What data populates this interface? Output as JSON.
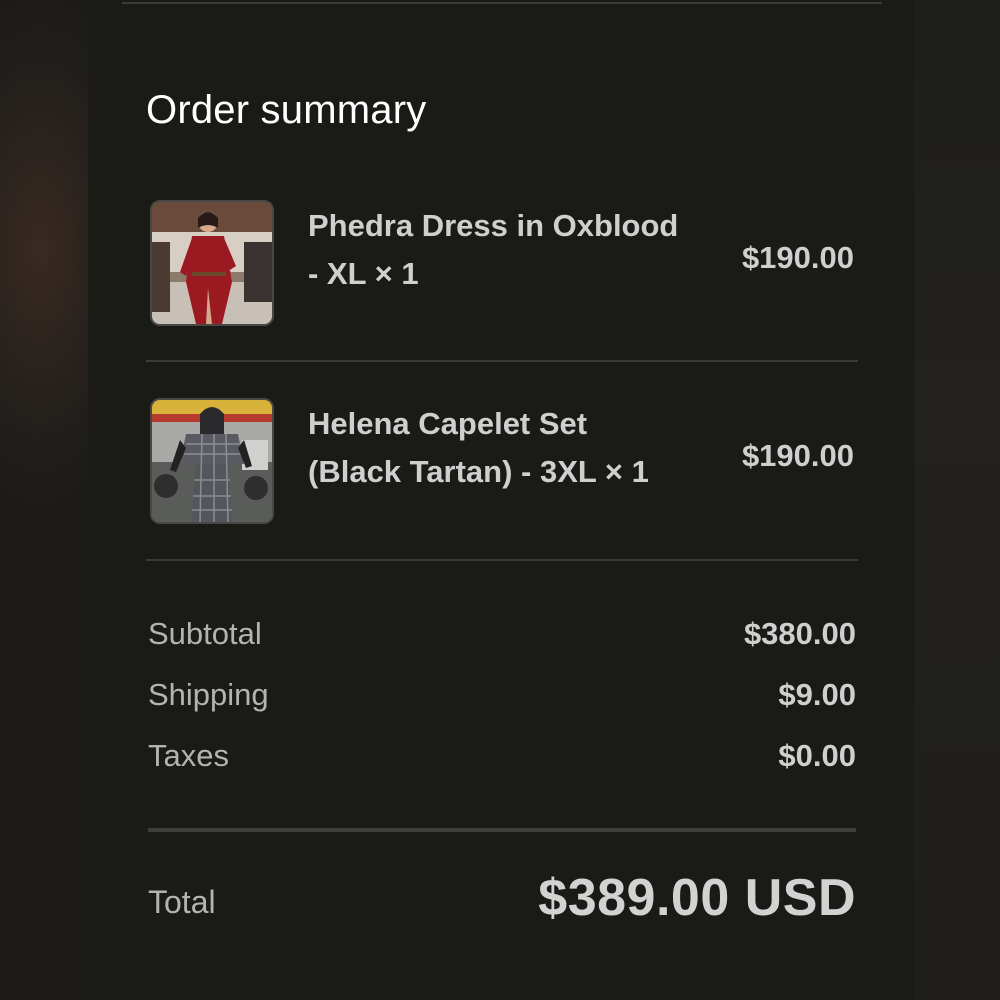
{
  "summary": {
    "title": "Order summary",
    "items": [
      {
        "name_line1": "Phedra Dress in Oxblood",
        "name_line2": "- XL × 1",
        "price": "$190.00",
        "thumbnail": "red-dress-photo"
      },
      {
        "name_line1": "Helena Capelet Set",
        "name_line2": "(Black Tartan) - 3XL × 1",
        "price": "$190.00",
        "thumbnail": "tartan-set-photo"
      }
    ],
    "subtotal_label": "Subtotal",
    "subtotal_value": "$380.00",
    "shipping_label": "Shipping",
    "shipping_value": "$9.00",
    "taxes_label": "Taxes",
    "taxes_value": "$0.00",
    "total_label": "Total",
    "total_value": "$389.00 USD"
  },
  "colors": {
    "background": "#1a1a17",
    "text_primary": "#ffffff",
    "text_secondary": "#cfcfcf",
    "text_muted": "#b3b3b3",
    "divider": "#3a3a37"
  }
}
